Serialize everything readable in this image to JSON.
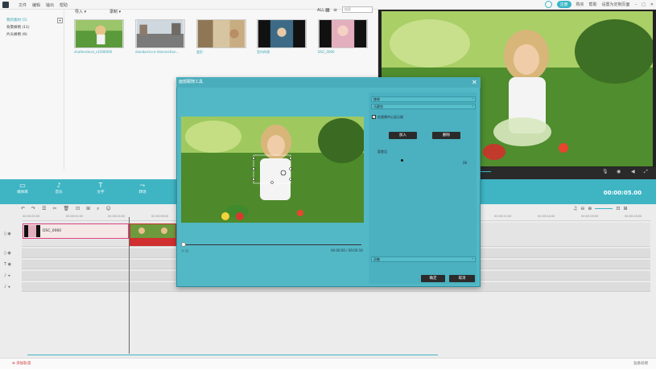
{
  "topbar": {
    "menu": [
      "文件",
      "编辑",
      "输出",
      "帮助"
    ],
    "register": "注册",
    "buy": "购买",
    "help": "帮助",
    "settings": "设置",
    "extra": "设置为定制页面"
  },
  "sidebar": {
    "items": [
      {
        "label": "我的素材 (5)"
      },
      {
        "label": "背景样例 (11)"
      },
      {
        "label": "片头样例 (9)"
      }
    ],
    "add": "+"
  },
  "library": {
    "import": "导入",
    "record": "录制",
    "all": "ALL",
    "search_placeholder": "搜索",
    "thumbs": [
      {
        "label": "shutterstock_v1006000"
      },
      {
        "label": "standard-cnr-intersection..."
      },
      {
        "label": "变形"
      },
      {
        "label": "室内的演"
      },
      {
        "label": "DSC_0060"
      }
    ]
  },
  "toolbar": {
    "items": [
      {
        "label": "媒体库",
        "icon": "folder-icon"
      },
      {
        "label": "音乐",
        "icon": "music-icon"
      },
      {
        "label": "文字",
        "icon": "text-icon"
      },
      {
        "label": "转场",
        "icon": "transition-icon"
      }
    ],
    "timecode": "00:00:05.00"
  },
  "timeline": {
    "ruler": [
      "00:00:00:00",
      "00:00:02:00",
      "00:00:04:00",
      "00:00:06:00",
      "00:00:22:00",
      "00:00:24:00",
      "00:00:26:00",
      "00:00:28:00"
    ],
    "clip_label": "DSC_0060",
    "add_track": "添加轨道"
  },
  "dialog": {
    "title": "面部跟随工具",
    "time": "00:00:00 / 00:00:10",
    "select_1": "移除",
    "select_2": "马赛克",
    "checkbox": "在视频中心显示帧",
    "add": "加入",
    "delete": "删除",
    "tolerance": "容差比",
    "tolerance_val": "26",
    "select_3": "灵敏",
    "ok": "确定",
    "cancel": "取消"
  },
  "bottombar": {
    "right": "准备就绪"
  },
  "colors": {
    "accent": "#3fb5c4",
    "dialog": "#53b8c6",
    "clip_red": "#d0302f"
  }
}
